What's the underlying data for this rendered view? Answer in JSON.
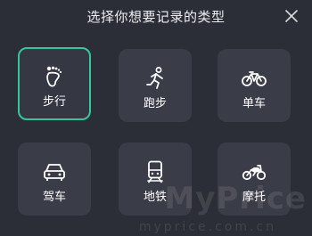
{
  "dialog": {
    "title": "选择你想要记录的类型",
    "close_icon": "close-icon"
  },
  "types": [
    {
      "label": "步行",
      "icon": "footprint-icon",
      "selected": true
    },
    {
      "label": "跑步",
      "icon": "running-person-icon",
      "selected": false
    },
    {
      "label": "单车",
      "icon": "bicycle-icon",
      "selected": false
    },
    {
      "label": "驾车",
      "icon": "car-icon",
      "selected": false
    },
    {
      "label": "地铁",
      "icon": "subway-icon",
      "selected": false
    },
    {
      "label": "摩托",
      "icon": "motorcycle-icon",
      "selected": false
    }
  ],
  "colors": {
    "background": "#2c2e37",
    "tile": "#3a3c47",
    "selected_border": "#35c79a",
    "text": "#ffffff"
  },
  "watermark": {
    "main": "MyPrice",
    "sub": "myprice.com.cn"
  }
}
